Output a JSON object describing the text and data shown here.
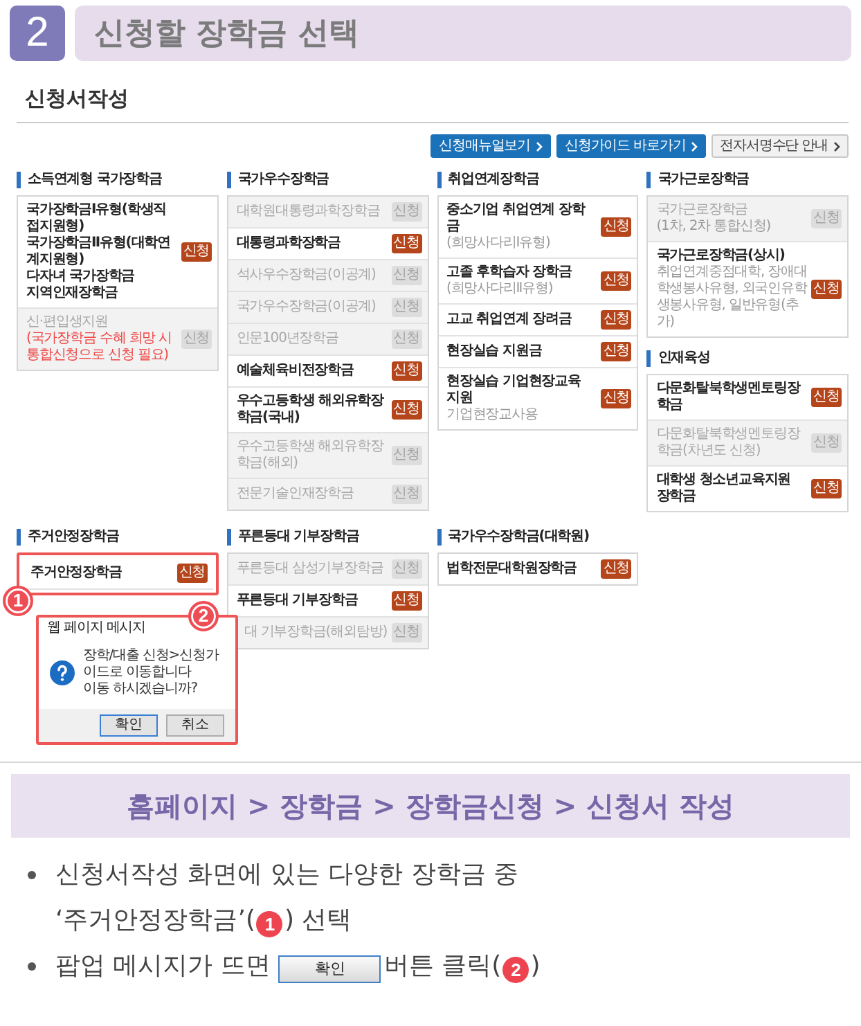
{
  "step": {
    "number": "2",
    "title": "신청할 장학금 선택"
  },
  "form": {
    "title": "신청서작성",
    "links": [
      {
        "label": "신청매뉴얼보기",
        "kind": "primary"
      },
      {
        "label": "신청가이드 바로가기",
        "kind": "primary"
      },
      {
        "label": "전자서명수단 안내",
        "kind": "plain"
      }
    ],
    "rows": [
      {
        "columns": [
          {
            "sections": [
              {
                "title": "소득연계형 국가장학금",
                "items": [
                  {
                    "lines": [
                      "국가장학금Ⅰ유형(학생직접지원형)",
                      "국가장학금Ⅱ유형(대학연계지원형)",
                      "다자녀 국가장학금",
                      "지역인재장학금"
                    ],
                    "button": "신청",
                    "disabled": false
                  },
                  {
                    "lines": [
                      "신·편입생지원"
                    ],
                    "note": "(국가장학금 수혜 희망 시 통합신청으로 신청 필요)",
                    "button": "신청",
                    "disabled": true
                  }
                ]
              }
            ]
          },
          {
            "sections": [
              {
                "title": "국가우수장학금",
                "items": [
                  {
                    "lines": [
                      "대학원대통령과학장학금"
                    ],
                    "button": "신청",
                    "disabled": true
                  },
                  {
                    "lines": [
                      "대통령과학장학금"
                    ],
                    "button": "신청",
                    "disabled": false
                  },
                  {
                    "lines": [
                      "석사우수장학금(이공계)"
                    ],
                    "button": "신청",
                    "disabled": true
                  },
                  {
                    "lines": [
                      "국가우수장학금(이공계)"
                    ],
                    "button": "신청",
                    "disabled": true
                  },
                  {
                    "lines": [
                      "인문100년장학금"
                    ],
                    "button": "신청",
                    "disabled": true
                  },
                  {
                    "lines": [
                      "예술체육비전장학금"
                    ],
                    "button": "신청",
                    "disabled": false
                  },
                  {
                    "lines": [
                      "우수고등학생 해외유학장학금(국내)"
                    ],
                    "button": "신청",
                    "disabled": false
                  },
                  {
                    "lines": [
                      "우수고등학생 해외유학장학금(해외)"
                    ],
                    "button": "신청",
                    "disabled": true
                  },
                  {
                    "lines": [
                      "전문기술인재장학금"
                    ],
                    "button": "신청",
                    "disabled": true
                  }
                ]
              }
            ]
          },
          {
            "sections": [
              {
                "title": "취업연계장학금",
                "items": [
                  {
                    "lines": [
                      "중소기업 취업연계 장학금"
                    ],
                    "sub": "(희망사다리Ⅰ유형)",
                    "button": "신청",
                    "disabled": false
                  },
                  {
                    "lines": [
                      "고졸 후학습자 장학금"
                    ],
                    "sub": "(희망사다리Ⅱ유형)",
                    "button": "신청",
                    "disabled": false
                  },
                  {
                    "lines": [
                      "고교 취업연계 장려금"
                    ],
                    "button": "신청",
                    "disabled": false
                  },
                  {
                    "lines": [
                      "현장실습 지원금"
                    ],
                    "button": "신청",
                    "disabled": false
                  },
                  {
                    "lines": [
                      "현장실습 기업현장교육 지원"
                    ],
                    "sub": "기업현장교사용",
                    "button": "신청",
                    "disabled": false
                  }
                ]
              }
            ]
          },
          {
            "sections": [
              {
                "title": "국가근로장학금",
                "items": [
                  {
                    "lines": [
                      "국가근로장학금"
                    ],
                    "sub": "(1차, 2차 통합신청)",
                    "button": "신청",
                    "disabled": true
                  },
                  {
                    "lines": [
                      "국가근로장학금(상시)"
                    ],
                    "sub": "취업연계중점대학, 장애대학생봉사유형, 외국인유학생봉사유형, 일반유형(추가)",
                    "button": "신청",
                    "disabled": false
                  }
                ]
              },
              {
                "title": "인재육성",
                "items": [
                  {
                    "lines": [
                      "다문화탈북학생멘토링장학금"
                    ],
                    "button": "신청",
                    "disabled": false
                  },
                  {
                    "lines": [
                      "다문화탈북학생멘토링장학금(차년도 신청)"
                    ],
                    "button": "신청",
                    "disabled": true
                  },
                  {
                    "lines": [
                      "대학생 청소년교육지원 장학금"
                    ],
                    "button": "신청",
                    "disabled": false
                  }
                ]
              }
            ]
          }
        ]
      },
      {
        "columns": [
          {
            "sections": [
              {
                "title": "주거안정장학금",
                "highlighted": true,
                "callout": "1",
                "items": [
                  {
                    "lines": [
                      "주거안정장학금"
                    ],
                    "button": "신청",
                    "disabled": false
                  }
                ]
              }
            ]
          },
          {
            "sections": [
              {
                "title": "푸른등대 기부장학금",
                "items": [
                  {
                    "lines": [
                      "푸른등대 삼성기부장학금"
                    ],
                    "button": "신청",
                    "disabled": true
                  },
                  {
                    "lines": [
                      "푸른등대 기부장학금"
                    ],
                    "button": "신청",
                    "disabled": false
                  },
                  {
                    "lines": [
                      "대 기부장학금(해외탐방)"
                    ],
                    "covered": true,
                    "button": "신청",
                    "disabled": true
                  }
                ]
              }
            ]
          },
          {
            "sections": [
              {
                "title": "국가우수장학금(대학원)",
                "items": [
                  {
                    "lines": [
                      "법학전문대학원장학금"
                    ],
                    "button": "신청",
                    "disabled": false
                  }
                ]
              }
            ]
          }
        ],
        "popup": {
          "title": "웹 페이지 메시지",
          "lines": [
            "장학/대출 신청>신청가이드로 이동합니다",
            "이동 하시겠습니까?"
          ],
          "buttons": [
            {
              "label": "확인",
              "focused": true
            },
            {
              "label": "취소",
              "focused": false
            }
          ],
          "callout": "2"
        }
      }
    ]
  },
  "breadcrumb": "홈페이지 > 장학금 > 장학금신청 > 신청서 작성",
  "instructions": [
    {
      "lines": [
        [
          {
            "kind": "text",
            "text": "신청서작성 화면에 있는 다양한 장학금 중"
          }
        ],
        [
          {
            "kind": "text",
            "text": "‘주거안정장학금’("
          },
          {
            "kind": "marker",
            "text": "1"
          },
          {
            "kind": "text",
            "text": ") 선택"
          }
        ]
      ]
    },
    {
      "lines": [
        [
          {
            "kind": "text",
            "text": "팝업 메시지가 뜨면"
          },
          {
            "kind": "button",
            "text": "확인"
          },
          {
            "kind": "text",
            "text": "버튼 클릭("
          },
          {
            "kind": "marker",
            "text": "2"
          },
          {
            "kind": "text",
            "text": ")"
          }
        ]
      ]
    }
  ]
}
